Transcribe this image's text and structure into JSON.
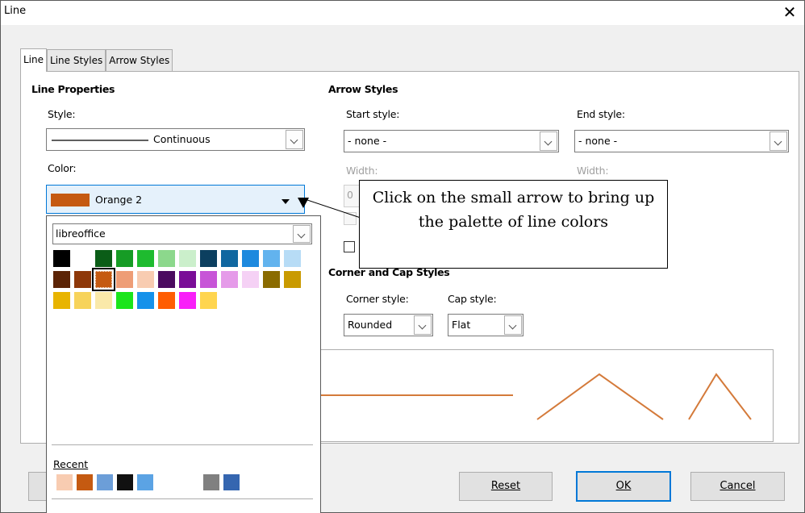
{
  "window": {
    "title": "Line"
  },
  "tabs": [
    {
      "label": "Line"
    },
    {
      "label": "Line Styles"
    },
    {
      "label": "Arrow Styles"
    }
  ],
  "line_properties": {
    "heading": "Line Properties",
    "style_label": "Style:",
    "style_value": "Continuous",
    "color_label": "Color:",
    "color_value": "Orange 2",
    "color_hex": "#c55a11"
  },
  "arrow_styles": {
    "heading": "Arrow Styles",
    "start_label": "Start style:",
    "start_value": "- none -",
    "end_label": "End style:",
    "end_value": "- none -",
    "width_label_left": "Width:",
    "width_label_right": "Width:",
    "width_value_left": "0"
  },
  "corner_cap": {
    "heading": "Corner and Cap Styles",
    "corner_label": "Corner style:",
    "corner_value": "Rounded",
    "cap_label": "Cap style:",
    "cap_value": "Flat"
  },
  "palette_popup": {
    "palette_value": "libreoffice",
    "swatches": [
      "#000000",
      "#ffffff",
      "#0b5d17",
      "#169c25",
      "#1ebb2f",
      "#8cd88c",
      "#cbefcb",
      "#0c3f5f",
      "#1067a0",
      "#1d89de",
      "#62b3ee",
      "#b7dcf6",
      "#5c2406",
      "#8e3809",
      "#c55a11",
      "#ee9d76",
      "#f8ccb1",
      "#4b0b60",
      "#7a0d97",
      "#c755d7",
      "#e59be9",
      "#f5d1f5",
      "#8a6b00",
      "#c99a00",
      "#e8b400",
      "#f7d35a",
      "#fae9a9",
      "#1be51b",
      "#1591ea",
      "#ff5d02",
      "#f91ff9",
      "#ffd54f"
    ],
    "selected_index": 14,
    "recent_label": "Recent",
    "recent_left": [
      "#f8ccb1",
      "#c55a11",
      "#6c9ed8",
      "#111111",
      "#5ba3e4"
    ],
    "recent_right": [
      "#808080",
      "#3566b0"
    ]
  },
  "callout": {
    "text": "Click on the small arrow to bring up the palette of line colors"
  },
  "buttons": {
    "reset": "Reset",
    "ok": "OK",
    "cancel": "Cancel"
  },
  "preview_color": "#d47a3a"
}
